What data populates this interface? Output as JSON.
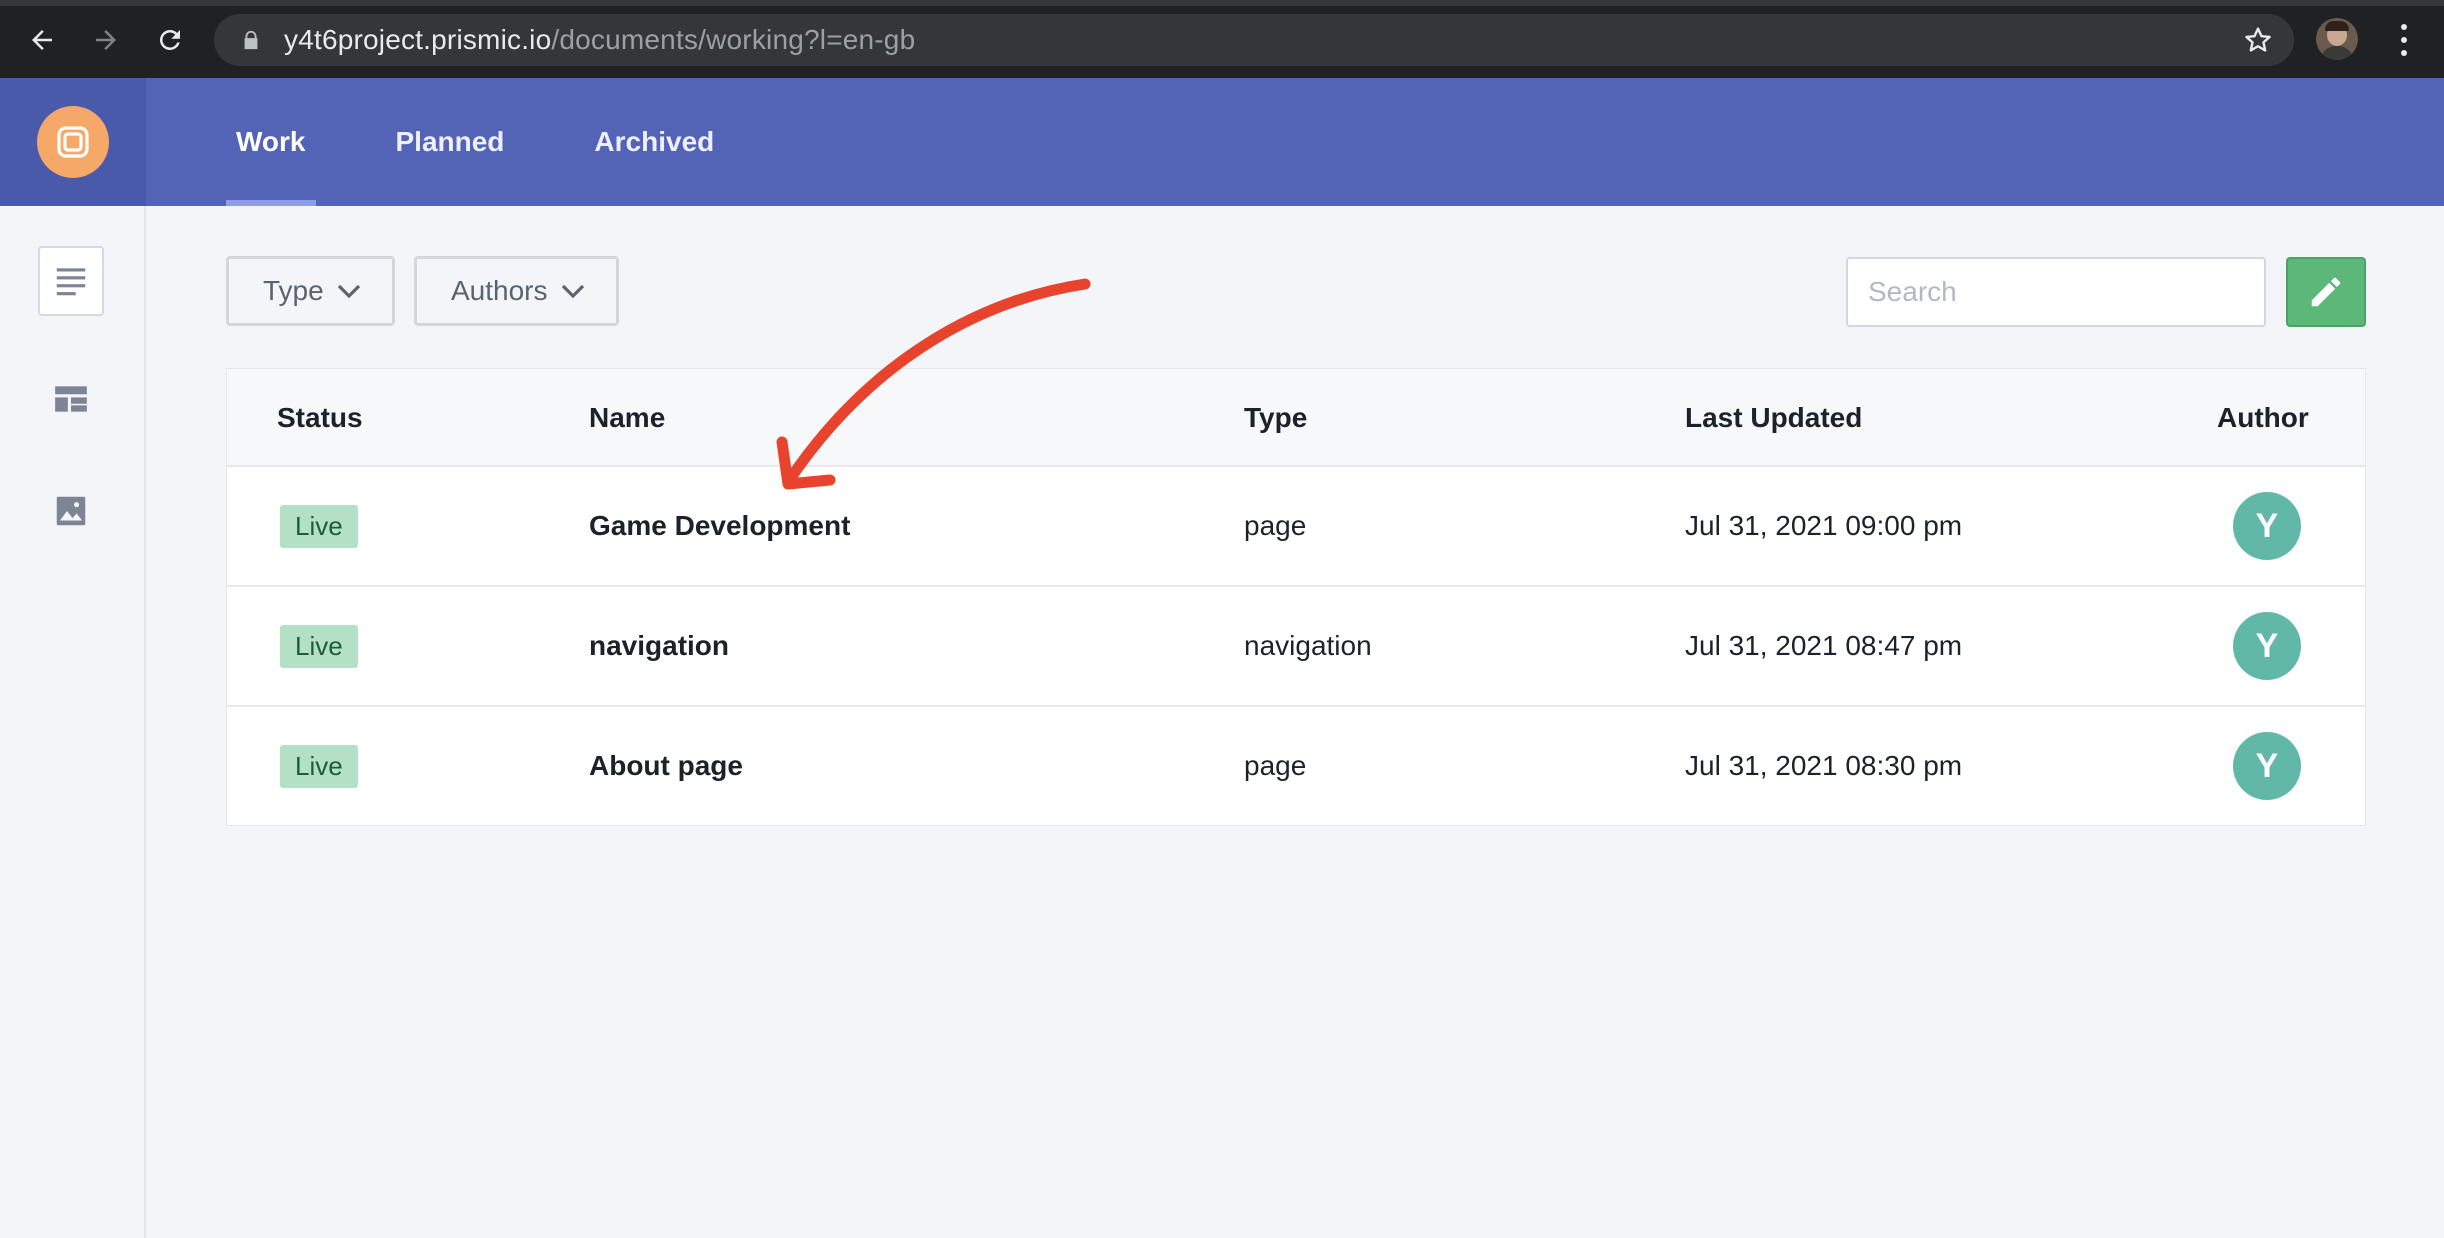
{
  "browser": {
    "url_host": "y4t6project.prismic.io",
    "url_path": "/documents/working?l=en-gb"
  },
  "header": {
    "tabs": [
      {
        "label": "Work",
        "active": true
      },
      {
        "label": "Planned",
        "active": false
      },
      {
        "label": "Archived",
        "active": false
      }
    ]
  },
  "sidebar": {
    "items": [
      {
        "icon": "documents-icon",
        "active": true
      },
      {
        "icon": "custom-types-icon",
        "active": false
      },
      {
        "icon": "media-library-icon",
        "active": false
      }
    ]
  },
  "toolbar": {
    "type_filter_label": "Type",
    "authors_filter_label": "Authors",
    "search_placeholder": "Search",
    "search_value": "",
    "new_document_icon": "pencil-icon"
  },
  "table": {
    "columns": {
      "status": "Status",
      "name": "Name",
      "type": "Type",
      "last_updated": "Last Updated",
      "author": "Author"
    },
    "rows": [
      {
        "status": "Live",
        "name": "Game Development",
        "type": "page",
        "last_updated": "Jul 31, 2021 09:00 pm",
        "author_initial": "Y"
      },
      {
        "status": "Live",
        "name": "navigation",
        "type": "navigation",
        "last_updated": "Jul 31, 2021 08:47 pm",
        "author_initial": "Y"
      },
      {
        "status": "Live",
        "name": "About page",
        "type": "page",
        "last_updated": "Jul 31, 2021 08:30 pm",
        "author_initial": "Y"
      }
    ]
  },
  "colors": {
    "header_bg": "#5363b5",
    "status_live_bg": "#b4e0c6",
    "avatar_bg": "#62b8a6",
    "new_button_bg": "#5cb878",
    "annotation_arrow": "#e8432d"
  }
}
